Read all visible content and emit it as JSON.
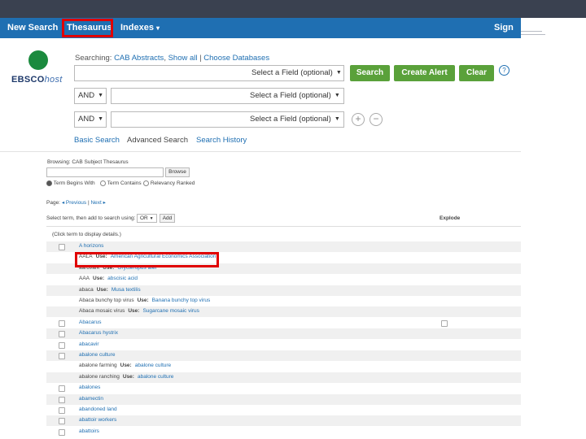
{
  "nav": {
    "new_search": "New Search",
    "thesaurus": "Thesaurus",
    "indexes": "Indexes",
    "indexes_caret": "▾",
    "sign_in": "Sign In"
  },
  "logo": {
    "brand": "EBSCO",
    "suffix": "host"
  },
  "searching": {
    "prefix": "Searching:",
    "database": "CAB Abstracts",
    "show_all": "Show all",
    "separator": "|",
    "choose_databases": "Choose Databases"
  },
  "search_rows": [
    {
      "operator": "",
      "field": "Select a Field (optional)"
    },
    {
      "operator": "AND",
      "field": "Select a Field (optional)"
    },
    {
      "operator": "AND",
      "field": "Select a Field (optional)"
    }
  ],
  "buttons": {
    "search": "Search",
    "create_alert": "Create Alert",
    "clear": "Clear",
    "help": "?",
    "add_row": "+",
    "remove_row": "−"
  },
  "sublinks": {
    "basic": "Basic Search",
    "advanced": "Advanced Search",
    "history": "Search History"
  },
  "thesaurus": {
    "browsing_label": "Browsing: CAB Subject Thesaurus",
    "browse_button": "Browse",
    "radios": [
      "Term Begins With",
      "Term Contains",
      "Relevancy Ranked"
    ],
    "page_label": "Page:",
    "previous": "◂ Previous",
    "next": "Next ▸",
    "select_label": "Select term, then add to search using:",
    "operator": "OR",
    "add_button": "Add",
    "explode_header": "Explode",
    "click_hint": "(Click term to display details.)",
    "terms": [
      {
        "checkbox": true,
        "term": "A horizons",
        "use": "",
        "target": "",
        "explode": false
      },
      {
        "checkbox": false,
        "term": "AALA",
        "use": "Use:",
        "target": "American Agricultural Economics Association",
        "explode": false
      },
      {
        "checkbox": false,
        "term": "aardvark",
        "use": "Use:",
        "target": "Orycteropus afer",
        "explode": false
      },
      {
        "checkbox": false,
        "term": "AAA",
        "use": "Use:",
        "target": "abscisic acid",
        "explode": false
      },
      {
        "checkbox": false,
        "term": "abaca",
        "use": "Use:",
        "target": "Musa textilis",
        "explode": false
      },
      {
        "checkbox": false,
        "term": "Abaca bunchy top virus",
        "use": "Use:",
        "target": "Banana bunchy top virus",
        "explode": false
      },
      {
        "checkbox": false,
        "term": "Abaca mosaic virus",
        "use": "Use:",
        "target": "Sugarcane mosaic virus",
        "explode": false
      },
      {
        "checkbox": true,
        "term": "Abacarus",
        "use": "",
        "target": "",
        "explode": true
      },
      {
        "checkbox": true,
        "term": "Abacarus hystrix",
        "use": "",
        "target": "",
        "explode": false
      },
      {
        "checkbox": true,
        "term": "abacavir",
        "use": "",
        "target": "",
        "explode": false
      },
      {
        "checkbox": true,
        "term": "abalone culture",
        "use": "",
        "target": "",
        "explode": false
      },
      {
        "checkbox": false,
        "term": "abalone farming",
        "use": "Use:",
        "target": "abalone culture",
        "explode": false
      },
      {
        "checkbox": false,
        "term": "abalone ranching",
        "use": "Use:",
        "target": "abalone culture",
        "explode": false
      },
      {
        "checkbox": true,
        "term": "abalones",
        "use": "",
        "target": "",
        "explode": false
      },
      {
        "checkbox": true,
        "term": "abamectin",
        "use": "",
        "target": "",
        "explode": false
      },
      {
        "checkbox": true,
        "term": "abandoned land",
        "use": "",
        "target": "",
        "explode": false
      },
      {
        "checkbox": true,
        "term": "abattoir workers",
        "use": "",
        "target": "",
        "explode": false
      },
      {
        "checkbox": true,
        "term": "abattoirs",
        "use": "",
        "target": "",
        "explode": false
      }
    ]
  }
}
